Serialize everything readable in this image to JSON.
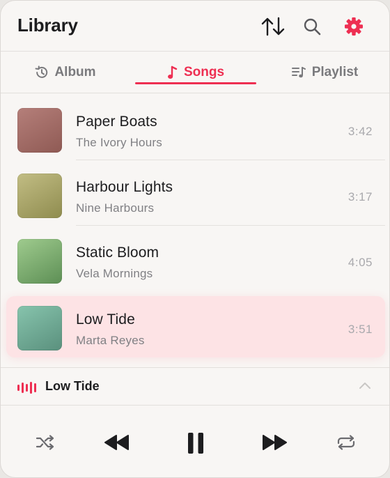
{
  "header": {
    "title": "Library"
  },
  "tabs": [
    {
      "label": "Album",
      "icon": "history-icon",
      "active": false
    },
    {
      "label": "Songs",
      "icon": "music-note-icon",
      "active": true
    },
    {
      "label": "Playlist",
      "icon": "playlist-icon",
      "active": false
    }
  ],
  "songs": [
    {
      "title": "Paper Boats",
      "artist": "The Ivory Hours",
      "duration": "3:42",
      "art_colors": [
        "#b57f7a",
        "#8f5a54"
      ]
    },
    {
      "title": "Harbour Lights",
      "artist": "Nine Harbours",
      "duration": "3:17",
      "art_colors": [
        "#c2bd84",
        "#8f8c4f"
      ]
    },
    {
      "title": "Static Bloom",
      "artist": "Vela Mornings",
      "duration": "4:05",
      "art_colors": [
        "#9fcb8e",
        "#5d8f55"
      ]
    },
    {
      "title": "Low Tide",
      "artist": "Marta Reyes",
      "duration": "3:51",
      "art_colors": [
        "#87c4ad",
        "#5a907d"
      ],
      "playing": true
    }
  ],
  "now_playing": {
    "title": "Low Tide"
  },
  "colors": {
    "accent": "#ee2f52",
    "background": "#f8f6f4",
    "text": "#1d1d1f",
    "secondary": "#808084"
  }
}
